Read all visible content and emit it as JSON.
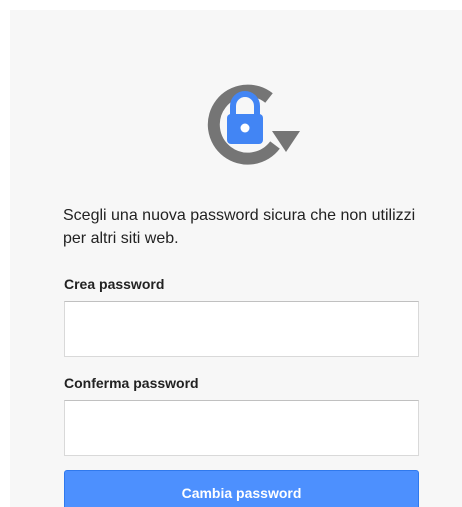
{
  "icon": {
    "name": "lock-refresh-icon",
    "ring_color": "#757575",
    "lock_color": "#4285f4"
  },
  "intro_text": "Scegli una nuova password sicura che non utilizzi per altri siti web.",
  "fields": {
    "new_password": {
      "label": "Crea password",
      "value": ""
    },
    "confirm_password": {
      "label": "Conferma password",
      "value": ""
    }
  },
  "submit_label": "Cambia password",
  "colors": {
    "accent": "#4d90fe",
    "card_background": "#f7f7f7",
    "text": "#222222"
  }
}
